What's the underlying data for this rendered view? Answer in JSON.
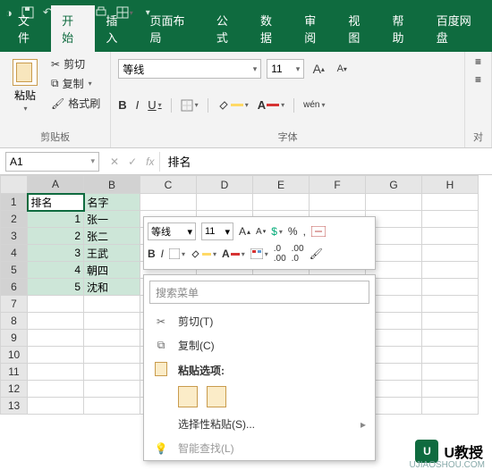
{
  "titlebar": {
    "icons": [
      "save-icon",
      "undo-icon",
      "redo-icon",
      "print-icon",
      "table-icon"
    ]
  },
  "tabs": [
    "文件",
    "开始",
    "插入",
    "页面布局",
    "公式",
    "数据",
    "审阅",
    "视图",
    "帮助",
    "百度网盘"
  ],
  "active_tab": 1,
  "ribbon": {
    "clipboard": {
      "paste": "粘贴",
      "cut": "剪切",
      "copy": "复制",
      "format_painter": "格式刷",
      "label": "剪贴板"
    },
    "font": {
      "name": "等线",
      "size": "11",
      "label": "字体",
      "buttons": {
        "bold": "B",
        "italic": "I",
        "underline": "U",
        "phonetic": "wén"
      },
      "increase": "A",
      "decrease": "A"
    },
    "align": {
      "label": "对"
    }
  },
  "formula_bar": {
    "name_box": "A1",
    "fx": "fx",
    "value": "排名"
  },
  "columns": [
    "A",
    "B",
    "C",
    "D",
    "E",
    "F",
    "G",
    "H"
  ],
  "rows": [
    "1",
    "2",
    "3",
    "4",
    "5",
    "6",
    "7",
    "8",
    "9",
    "10",
    "11",
    "12",
    "13"
  ],
  "cells": {
    "A1": "排名",
    "B1": "名字",
    "A2": "1",
    "B2": "张一",
    "A3": "2",
    "B3": "张二",
    "A4": "3",
    "B4": "王武",
    "A5": "4",
    "B5": "朝四",
    "A6": "5",
    "B6": "沈和"
  },
  "selected_cols": [
    "A",
    "B"
  ],
  "selected_rows": [
    "1",
    "2",
    "3",
    "4",
    "5",
    "6"
  ],
  "mini_toolbar": {
    "font": "等线",
    "size": "11",
    "percent": "%",
    "comma": ","
  },
  "context_menu": {
    "search_placeholder": "搜索菜单",
    "cut": "剪切(T)",
    "copy": "复制(C)",
    "paste_options": "粘贴选项:",
    "paste_special": "选择性粘贴(S)...",
    "smart_lookup": "智能查找(L)"
  },
  "watermark": {
    "badge": "U",
    "text": "U教授",
    "url": "UJIAOSHOU.COM"
  }
}
